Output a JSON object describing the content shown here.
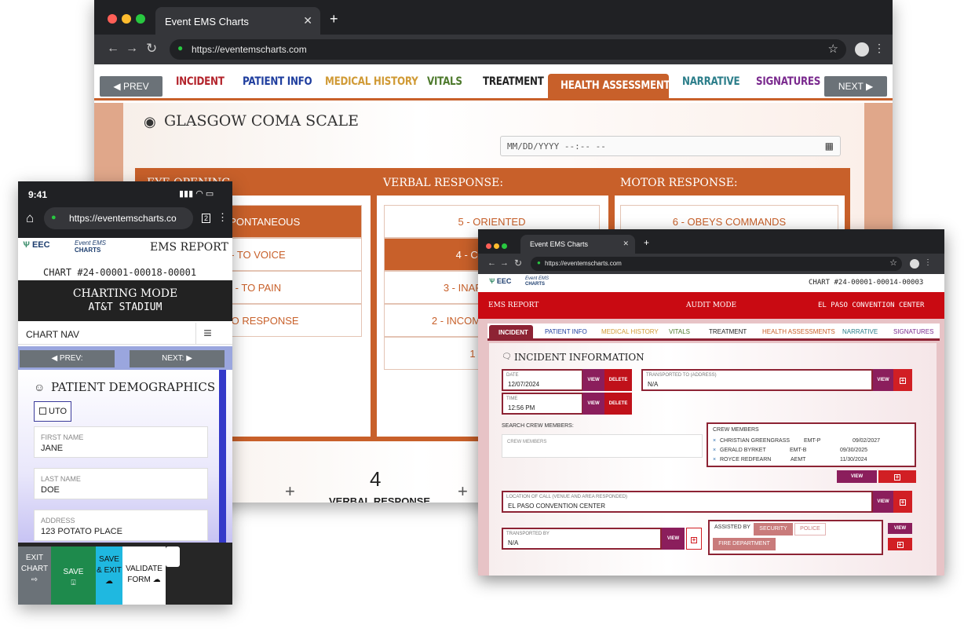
{
  "back_window": {
    "tab_title": "Event EMS Charts",
    "url": "https://eventemscharts.com",
    "prev_label": "PREV",
    "next_label": "NEXT",
    "tabs": [
      {
        "label": "INCIDENT",
        "color": "#b3232b"
      },
      {
        "label": "PATIENT INFO",
        "color": "#1f3e9e"
      },
      {
        "label": "MEDICAL HISTORY",
        "color": "#d09a35"
      },
      {
        "label": "VITALS",
        "color": "#4e7a2d"
      },
      {
        "label": "TREATMENT",
        "color": "#222222"
      },
      {
        "label": "HEALTH ASSESSMENTS",
        "color": "#ffffff"
      },
      {
        "label": "NARRATIVE",
        "color": "#2c7e8a"
      },
      {
        "label": "SIGNATURES",
        "color": "#7a2a8e"
      }
    ],
    "section_title": "GLASGOW COMA SCALE",
    "datetime_placeholder": "MM/DD/YYYY --:-- --",
    "eye_header": "EYE OPENING",
    "verbal_header": "VERBAL RESPONSE:",
    "motor_header": "MOTOR RESPONSE:",
    "eye_options": [
      "4 - SPONTANEOUS",
      "3 - TO VOICE",
      "2 - TO PAIN",
      "1 - NO RESPONSE"
    ],
    "verbal_options": [
      "5 - ORIENTED",
      "4 - CONFUSED",
      "3 - INAPPROPRIATE",
      "2 - INCOMPREHENSIBLE",
      "1 - NONE"
    ],
    "motor_options": [
      "6 - OBEYS COMMANDS"
    ],
    "verbal_score": "4",
    "verbal_score_label": "VERBAL RESPONSE",
    "plus_sign": "+",
    "accent_color": "#c8602a"
  },
  "phone": {
    "time": "9:41",
    "url": "https://eventemscharts.co",
    "tab_count": "2",
    "logo_eec": "EEC",
    "logo_event": "Event EMS",
    "logo_charts": "CHARTS",
    "report_title": "EMS REPORT",
    "chart_id": "CHART #24-00001-00018-00001",
    "mode": "CHARTING MODE",
    "venue": "AT&T STADIUM",
    "chart_nav": "CHART NAV",
    "prev": "PREV:",
    "next": "NEXT:",
    "section_title": "PATIENT DEMOGRAPHICS",
    "uto_label": "UTO",
    "fields": [
      {
        "label": "FIRST NAME",
        "value": "JANE"
      },
      {
        "label": "LAST NAME",
        "value": "DOE"
      },
      {
        "label": "ADDRESS",
        "value": "123 POTATO PLACE"
      }
    ],
    "bottom": {
      "exit": "EXIT CHART",
      "save": "SAVE",
      "save_exit": "SAVE & EXIT",
      "validate": "VALIDATE FORM"
    }
  },
  "front_window": {
    "tab_title": "Event EMS Charts",
    "url": "https://eventemscharts.com",
    "chart_id": "CHART #24-00001-00014-00003",
    "report_title": "EMS REPORT",
    "mode": "AUDIT MODE",
    "venue": "EL PASO CONVENTION CENTER",
    "tabs": [
      {
        "label": "INCIDENT",
        "color": "#ffffff"
      },
      {
        "label": "PATIENT INFO",
        "color": "#1f3e9e"
      },
      {
        "label": "MEDICAL HISTORY",
        "color": "#d09a35"
      },
      {
        "label": "VITALS",
        "color": "#4e7a2d"
      },
      {
        "label": "TREATMENT",
        "color": "#222222"
      },
      {
        "label": "HEALTH ASSESSMENTS",
        "color": "#c8602a"
      },
      {
        "label": "NARRATIVE",
        "color": "#2c7e8a"
      },
      {
        "label": "SIGNATURES",
        "color": "#7a2a8e"
      }
    ],
    "section_title": "INCIDENT INFORMATION",
    "date_label": "DATE",
    "date_value": "12/07/2024",
    "time_label": "TIME",
    "time_value": "12:56 PM",
    "view": "VIEW",
    "delete": "DELETE",
    "transported_to_label": "TRANSPORTED TO (ADDRESS)",
    "transported_to_value": "N/A",
    "search_crew_label": "SEARCH CREW MEMBERS:",
    "crew_placeholder": "CREW MEMBERS",
    "crew_title": "CREW MEMBERS",
    "crew": [
      {
        "name": "CHRISTIAN GREENGRASS",
        "cert": "EMT-P",
        "date": "09/02/2027"
      },
      {
        "name": "GERALD BYRKET",
        "cert": "EMT-B",
        "date": "09/30/2025"
      },
      {
        "name": "ROYCE REDFEARN",
        "cert": "AEMT",
        "date": "11/30/2024"
      }
    ],
    "location_label": "LOCATION OF CALL (VENUE AND AREA RESPONDED)",
    "location_value": "EL PASO CONVENTION CENTER",
    "transported_by_label": "TRANSPORTED BY",
    "transported_by_value": "N/A",
    "assisted_by_label": "ASSISTED BY",
    "assisted": [
      "SECURITY",
      "POLICE",
      "FIRE DEPARTMENT"
    ]
  }
}
